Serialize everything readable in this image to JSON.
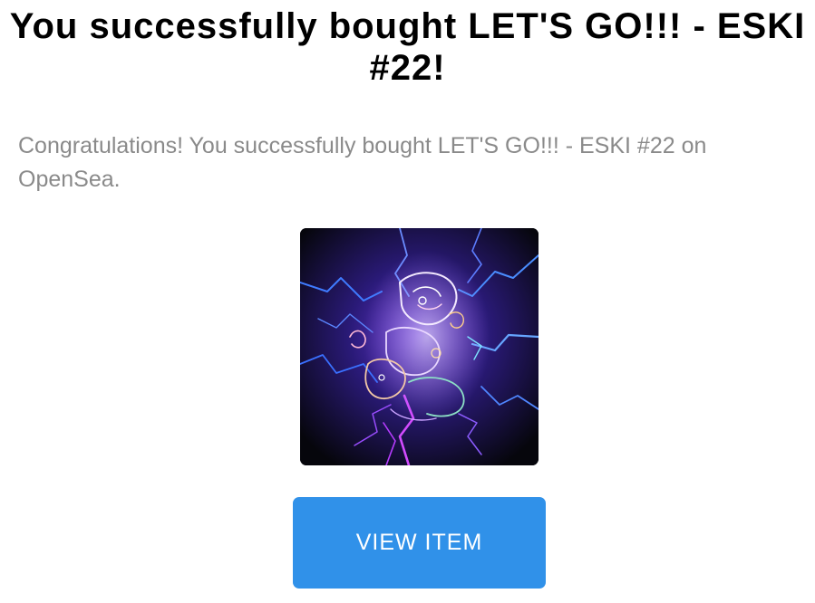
{
  "purchase": {
    "title": "You successfully bought LET'S GO!!! - ESKI #22!",
    "message": "Congratulations! You successfully bought LET'S GO!!! - ESKI #22 on OpenSea.",
    "image_alt": "LET'S GO!!! - ESKI #22",
    "button_label": "VIEW ITEM"
  },
  "colors": {
    "button_bg": "#3091e9",
    "message_text": "#8a8a8a",
    "title_text": "#000000"
  }
}
